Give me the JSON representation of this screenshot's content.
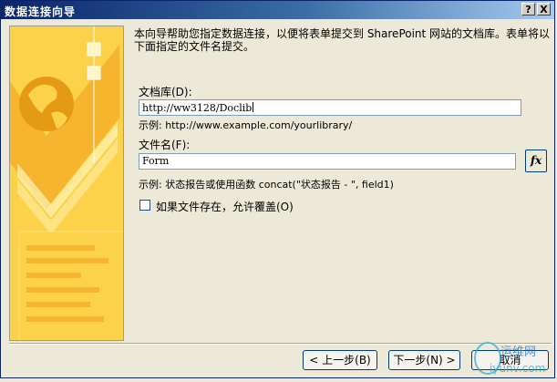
{
  "window": {
    "title": "数据连接向导",
    "help_label": "?",
    "close_label": "X"
  },
  "intro_text": "本向导帮助您指定数据连接，以便将表单提交到 SharePoint 网站的文档库。表单将以下面指定的文件名提交。",
  "library": {
    "label": "文档库(D):",
    "value": "http://ww3128/Doclib",
    "example": "示例: http://www.example.com/yourlibrary/"
  },
  "filename": {
    "label": "文件名(F):",
    "value": "Form",
    "fx_label": "fx",
    "example": "示例: 状态报告或使用函数 concat(\"状态报告 - \", field1)"
  },
  "overwrite": {
    "label": "如果文件存在，允许覆盖(O)",
    "checked": false
  },
  "buttons": {
    "back": "< 上一步(B)",
    "next": "下一步(N) >",
    "cancel": "取消"
  },
  "watermark": {
    "site": "运维网",
    "url": "iyunv.com"
  },
  "colors": {
    "title_bar": "#0a246a",
    "art_yellow": "#fbd24a",
    "art_orange": "#f4a21c"
  }
}
